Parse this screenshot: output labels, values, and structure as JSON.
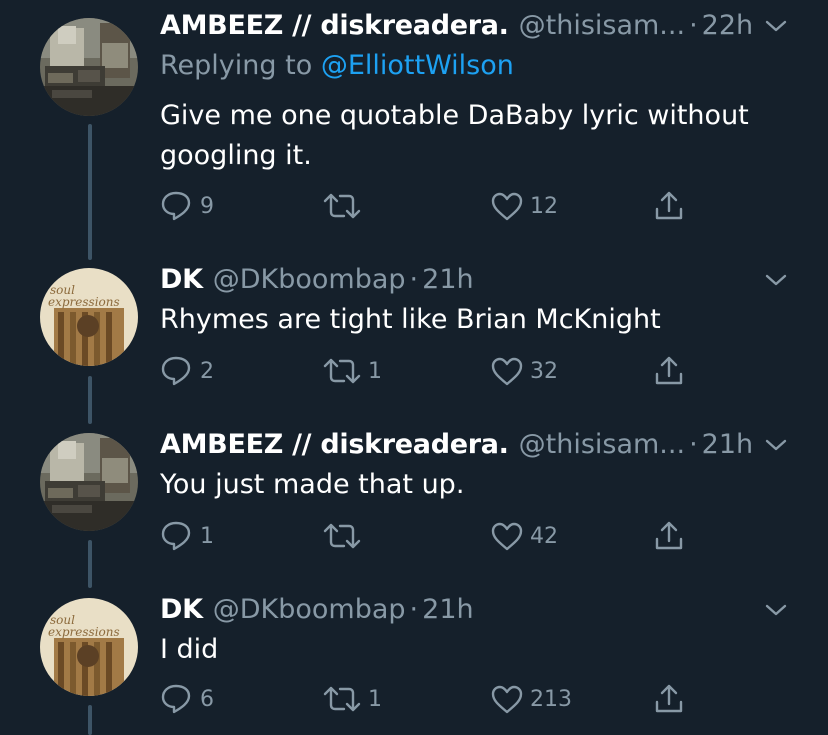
{
  "tweets": [
    {
      "name": "AMBEEZ // diskreadera.",
      "handle": "@thisisam...",
      "dot": "·",
      "time": "22h",
      "replying_prefix": "Replying to ",
      "replying_to": "@ElliottWilson",
      "text_lines": [
        "Give me one quotable DaBaby lyric without",
        "googling it."
      ],
      "reply_count": "9",
      "retweet_count": "",
      "like_count": "12"
    },
    {
      "name": "DK",
      "handle": "@DKboombap",
      "dot": "·",
      "time": "21h",
      "text_lines": [
        "Rhymes are tight like Brian McKnight"
      ],
      "reply_count": "2",
      "retweet_count": "1",
      "like_count": "32"
    },
    {
      "name": "AMBEEZ // diskreadera.",
      "handle": "@thisisam...",
      "dot": "·",
      "time": "21h",
      "text_lines": [
        "You just made that up."
      ],
      "reply_count": "1",
      "retweet_count": "",
      "like_count": "42"
    },
    {
      "name": "DK",
      "handle": "@DKboombap",
      "dot": "·",
      "time": "21h",
      "text_lines": [
        "I did"
      ],
      "reply_count": "6",
      "retweet_count": "1",
      "like_count": "213"
    }
  ],
  "avatar_text": {
    "line1": "soul",
    "line2": "expressions"
  },
  "icons": {
    "reply": "reply-icon",
    "retweet": "retweet-icon",
    "like": "heart-icon",
    "share": "share-icon",
    "menu": "chevron-down-icon"
  },
  "colors": {
    "background": "#15202b",
    "text": "#ffffff",
    "secondary": "#8899a6",
    "link": "#1da1f2",
    "thread_line": "#3d5466"
  }
}
